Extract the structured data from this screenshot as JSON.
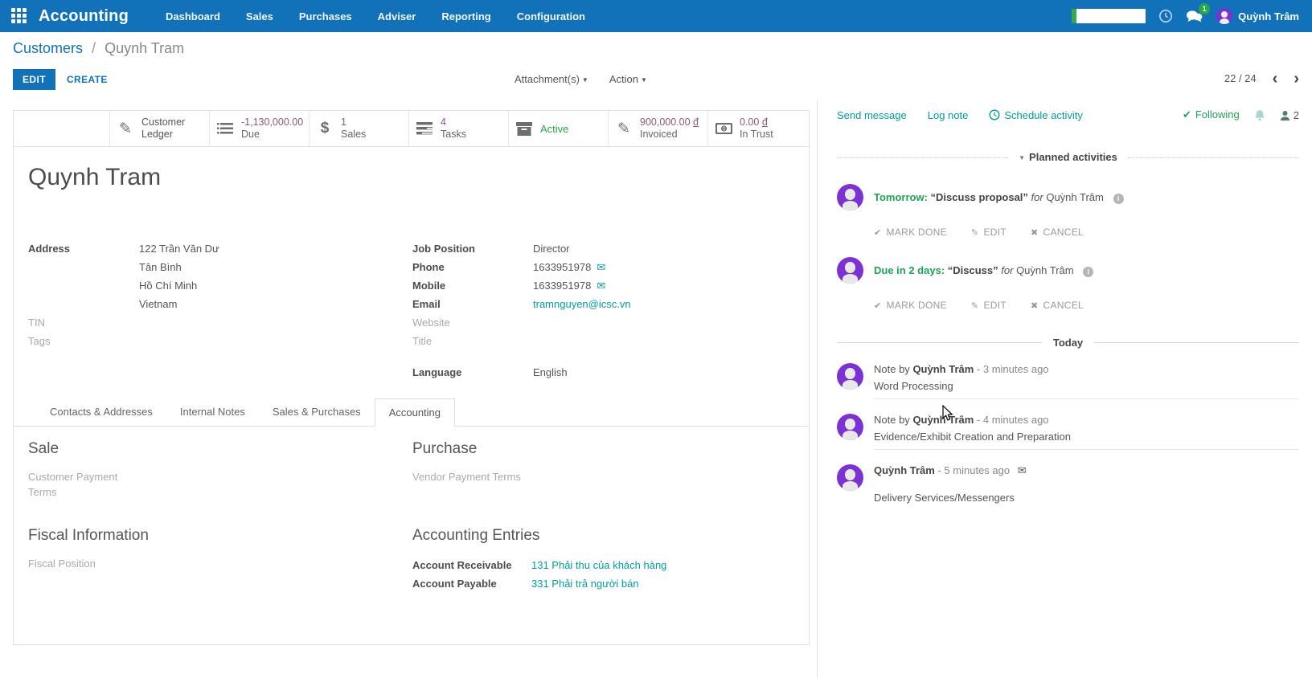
{
  "colors": {
    "navbar": "#1272b9",
    "link_blue": "#1272b9",
    "teal": "#00a09d",
    "green": "#1fa25a",
    "status_green": "#28a745",
    "stat_value": "#875a7b",
    "avatar_purple": "#7c31d2"
  },
  "nav": {
    "app_title": "Accounting",
    "menus": [
      {
        "label": "Dashboard"
      },
      {
        "label": "Sales"
      },
      {
        "label": "Purchases"
      },
      {
        "label": "Adviser"
      },
      {
        "label": "Reporting"
      },
      {
        "label": "Configuration"
      }
    ],
    "messages_badge": "1",
    "user_name": "Quỳnh Trâm"
  },
  "control_panel": {
    "breadcrumb": {
      "parent": "Customers",
      "separator": "/",
      "current": "Quynh Tram"
    },
    "edit_label": "EDIT",
    "create_label": "CREATE",
    "attachments_label": "Attachment(s)",
    "action_label": "Action",
    "pager_value": "22 / 24"
  },
  "stats": [
    {
      "icon": "edit-icon",
      "line1": "Customer",
      "line2": "Ledger"
    },
    {
      "icon": "list-icon",
      "value": "-1,130,000.00",
      "label": "Due"
    },
    {
      "icon": "dollar-icon",
      "value": "1",
      "label": "Sales"
    },
    {
      "icon": "tasks-icon",
      "value": "4",
      "label": "Tasks"
    },
    {
      "icon": "archive-icon",
      "status": "Active"
    },
    {
      "icon": "edit-icon",
      "value": "900,000.00",
      "currency": "đ",
      "label": "Invoiced"
    },
    {
      "icon": "money-icon",
      "value": "0.00",
      "currency": "đ",
      "label": "In Trust"
    }
  ],
  "form": {
    "name": "Quynh Tram",
    "address": {
      "label": "Address",
      "lines": [
        "122 Trần Văn Dư",
        "Tân Bình",
        "Hồ Chí Minh",
        "Vietnam"
      ]
    },
    "tin": {
      "label": "TIN"
    },
    "tags": {
      "label": "Tags"
    },
    "job_position": {
      "label": "Job Position",
      "value": "Director"
    },
    "phone": {
      "label": "Phone",
      "value": "1633951978"
    },
    "mobile": {
      "label": "Mobile",
      "value": "1633951978"
    },
    "email": {
      "label": "Email",
      "value": "tramnguyen@icsc.vn"
    },
    "website": {
      "label": "Website"
    },
    "title": {
      "label": "Title"
    },
    "language": {
      "label": "Language",
      "value": "English"
    }
  },
  "tabs": [
    {
      "label": "Contacts & Addresses"
    },
    {
      "label": "Internal Notes"
    },
    {
      "label": "Sales & Purchases"
    },
    {
      "label": "Accounting"
    }
  ],
  "accounting_tab": {
    "sale": {
      "heading": "Sale",
      "field": "Customer Payment Terms"
    },
    "purchase": {
      "heading": "Purchase",
      "field": "Vendor Payment Terms"
    },
    "fiscal": {
      "heading": "Fiscal Information",
      "field": "Fiscal Position"
    },
    "entries": {
      "heading": "Accounting Entries",
      "receivable": {
        "label": "Account Receivable",
        "value": "131 Phải thu của khách hàng"
      },
      "payable": {
        "label": "Account Payable",
        "value": "331 Phải trả người bán"
      }
    }
  },
  "chatter": {
    "send_label": "Send message",
    "log_label": "Log note",
    "schedule_label": "Schedule activity",
    "following_label": "Following",
    "followers_count": "2",
    "planned_title": "Planned activities",
    "actions": {
      "done": "MARK DONE",
      "edit": "EDIT",
      "cancel": "CANCEL"
    },
    "activities": [
      {
        "due": "Tomorrow:",
        "summary": "“Discuss proposal”",
        "for_word": "for",
        "assignee": "Quỳnh Trâm"
      },
      {
        "due": "Due in 2 days:",
        "summary": "“Discuss”",
        "for_word": "for",
        "assignee": "Quỳnh Trâm"
      }
    ],
    "today_label": "Today",
    "messages": [
      {
        "prefix": "Note by",
        "author": "Quỳnh Trâm",
        "time": "- 3 minutes ago",
        "body": "Word Processing"
      },
      {
        "prefix": "Note by",
        "author": "Quỳnh Trâm",
        "time": "- 4 minutes ago",
        "body": "Evidence/Exhibit Creation and Preparation"
      },
      {
        "prefix": "",
        "author": "Quỳnh Trâm",
        "time": "- 5 minutes ago",
        "body": "Delivery Services/Messengers"
      }
    ]
  }
}
